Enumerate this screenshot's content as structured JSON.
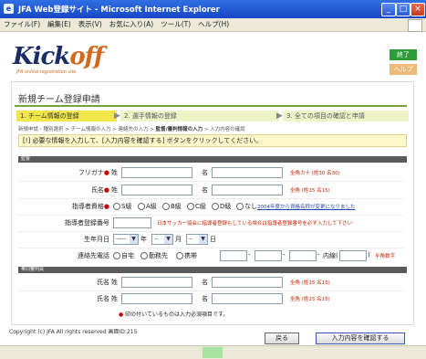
{
  "window": {
    "title": "JFA Web登録サイト - Microsoft Internet Explorer",
    "min": "_",
    "max": "□",
    "close": "×"
  },
  "menu": [
    "ファイル(F)",
    "編集(E)",
    "表示(V)",
    "お気に入り(A)",
    "ツール(T)",
    "ヘルプ(H)"
  ],
  "header": {
    "logo_main": "Kick",
    "logo_off": "off",
    "logo_sub": "JFA online registration site",
    "end_button": "終了",
    "help_button": "ヘルプ"
  },
  "page": {
    "title": "新規チーム登録申請",
    "steps": [
      "1. チーム情報の登録",
      "2. 選手情報の登録",
      "3. 全ての項目の確認と申請"
    ],
    "breadcrumb_pre": "新規申請・種別選択 > チーム情報の入力 > 連絡先の入力 > ",
    "breadcrumb_bold": "監督/審判情報の入力",
    "breadcrumb_post": " > 入力内容の確認",
    "notice": "[!] 必要な情報を入力して、[入力内容を確認する] ボタンをクリックしてください。"
  },
  "section_manager": {
    "header": "監督",
    "furigana_label": "フリガナ",
    "name_label": "氏名",
    "sei": "姓",
    "mei": "名",
    "furigana_hint": "全角カナ (姓30 名30)",
    "name_hint": "全角 (姓15 名15)",
    "license_label": "指導者資格",
    "license_options": [
      "S級",
      "A級",
      "B級",
      "C級",
      "D級",
      "なし"
    ],
    "license_link": "2004年度から資格名称が変更になりました",
    "regno_label": "指導者登録番号",
    "regno_hint": "日本サッカー協会に指導者登録もしている場合は指導者登録番号を必ず入力して下さい",
    "birth_label": "生年月日",
    "birth_year": "-----",
    "year_unit": "年",
    "month_unit": "月",
    "day_unit": "日",
    "birth_month": "--",
    "birth_day": "--",
    "contact_label": "連絡先電話",
    "contact_options": [
      "自宅",
      "勤務先",
      "携帯"
    ],
    "ext_label": "内線(",
    "ext_close": ")",
    "ext_hint": "半角数字"
  },
  "section_referee": {
    "header": "帯同審判員",
    "name_label": "氏名",
    "sei": "姓",
    "mei": "名",
    "name_hint": "全角 (姓15 名15)",
    "required_note": "印の付いているものは入力必須項目です。"
  },
  "footer": {
    "copyright": "Copyright (c) JFA All rights reserved 画面ID:215",
    "back_button": "戻る",
    "confirm_button": "入力内容を確認する"
  }
}
